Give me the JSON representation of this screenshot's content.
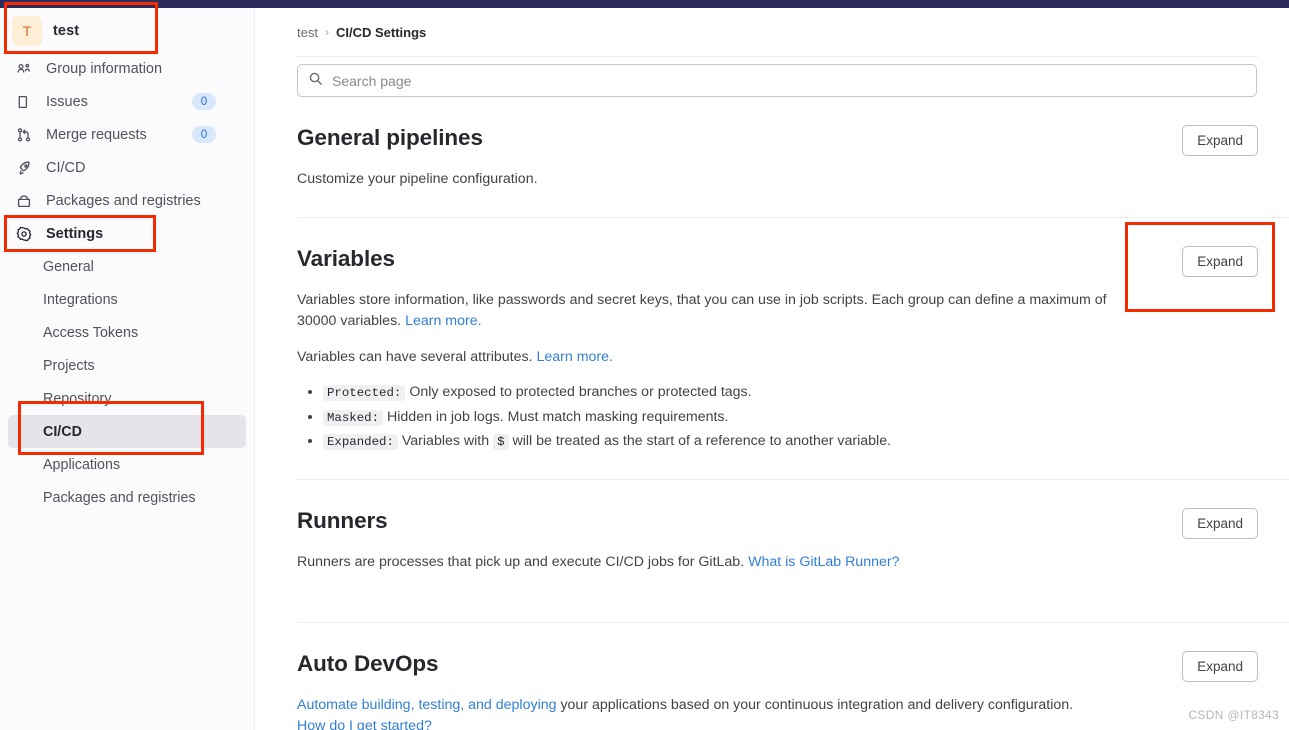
{
  "colors": {
    "topbar": "#2b2b5e",
    "annotation": "#f42a00",
    "accent_link": "#337fd3",
    "badge_bg": "#d8e7fb",
    "badge_text": "#2b72d1",
    "avatar_bg": "#fceed7",
    "avatar_text": "#d06f20",
    "active_row_bg": "#e6e4e9",
    "sidebar_bg": "#fbfafd"
  },
  "sidebar": {
    "context": {
      "avatar_letter": "T",
      "name": "test"
    },
    "items": [
      {
        "label": "Group information",
        "icon": "group-information-icon",
        "badge": null
      },
      {
        "label": "Issues",
        "icon": "issues-icon",
        "badge": "0"
      },
      {
        "label": "Merge requests",
        "icon": "merge-requests-icon",
        "badge": "0"
      },
      {
        "label": "CI/CD",
        "icon": "rocket-icon",
        "badge": null
      },
      {
        "label": "Packages and registries",
        "icon": "package-icon",
        "badge": null
      },
      {
        "label": "Settings",
        "icon": "gear-icon",
        "badge": null
      }
    ],
    "subitems": [
      {
        "label": "General",
        "active": false
      },
      {
        "label": "Integrations",
        "active": false
      },
      {
        "label": "Access Tokens",
        "active": false
      },
      {
        "label": "Projects",
        "active": false
      },
      {
        "label": "Repository",
        "active": false
      },
      {
        "label": "CI/CD",
        "active": true
      },
      {
        "label": "Applications",
        "active": false
      },
      {
        "label": "Packages and registries",
        "active": false
      }
    ]
  },
  "breadcrumb": {
    "root": "test",
    "separator": "›",
    "current": "CI/CD Settings"
  },
  "search": {
    "placeholder": "Search page",
    "value": "",
    "icon": "search-icon"
  },
  "sections": [
    {
      "id": "general-pipelines",
      "title": "General pipelines",
      "expand_label": "Expand",
      "description": "Customize your pipeline configuration."
    },
    {
      "id": "variables",
      "title": "Variables",
      "expand_label": "Expand",
      "paragraph1_text": "Variables store information, like passwords and secret keys, that you can use in job scripts. Each group can define a maximum of 30000 variables. ",
      "paragraph1_link": "Learn more.",
      "paragraph2_text": "Variables can have several attributes. ",
      "paragraph2_link": "Learn more.",
      "attributes": [
        {
          "code": "Protected:",
          "text": "Only exposed to protected branches or protected tags."
        },
        {
          "code": "Masked:",
          "text": "Hidden in job logs. Must match masking requirements."
        },
        {
          "code": "Expanded:",
          "text_before": "Variables with",
          "inline_code": "$",
          "text_after": "will be treated as the start of a reference to another variable."
        }
      ]
    },
    {
      "id": "runners",
      "title": "Runners",
      "expand_label": "Expand",
      "description": "Runners are processes that pick up and execute CI/CD jobs for GitLab. ",
      "link": "What is GitLab Runner?"
    },
    {
      "id": "auto-devops",
      "title": "Auto DevOps",
      "expand_label": "Expand",
      "link1": "Automate building, testing, and deploying",
      "text_after_link1": " your applications based on your continuous integration and delivery configuration.",
      "link2": "How do I get started?"
    }
  ],
  "watermark": "CSDN @IT8343"
}
